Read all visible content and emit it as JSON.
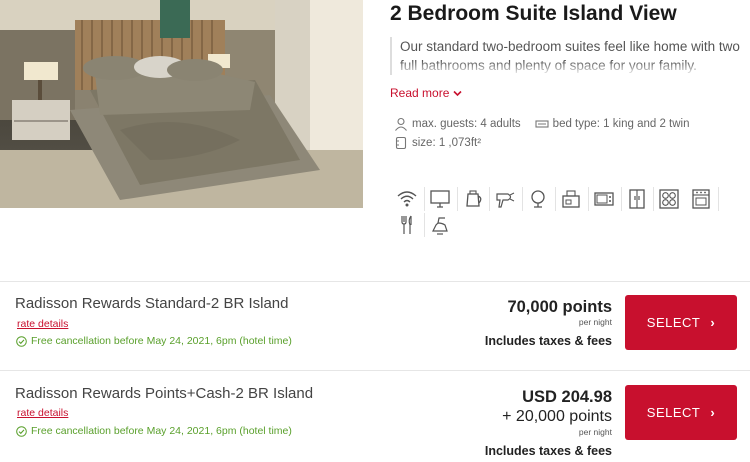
{
  "room": {
    "title": "2 Bedroom Suite Island View",
    "description": "Our standard two-bedroom suites feel like home with two full bathrooms and plenty of space for your family.",
    "read_more": "Read more",
    "guests": "max. guests: 4 adults",
    "bed": "bed type: 1 king and 2 twin",
    "size": "size: 1 ,073ft²"
  },
  "amenities": [
    "wifi-icon",
    "tv-icon",
    "kettle-icon",
    "hair-dryer-icon",
    "vanity-mirror-icon",
    "coffee-maker-icon",
    "microwave-icon",
    "refrigerator-icon",
    "cooktop-icon",
    "oven-icon",
    "cutlery-icon",
    "iron-icon"
  ],
  "rates": [
    {
      "name": "Radisson Rewards Standard-2 BR Island",
      "details_label": "rate details",
      "cancellation": "Free cancellation before May 24, 2021, 6pm (hotel time)",
      "price_main": "70,000 points",
      "per_night": "per night",
      "taxes": "Includes taxes & fees",
      "button": "SELECT"
    },
    {
      "name": "Radisson Rewards Points+Cash-2 BR Island",
      "details_label": "rate details",
      "cancellation": "Free cancellation before May 24, 2021, 6pm (hotel time)",
      "price_main": "USD 204.98",
      "price_extra": "+ 20,000 points",
      "per_night": "per night",
      "taxes": "Includes taxes & fees",
      "button": "SELECT"
    }
  ],
  "colors": {
    "accent": "#c8102e",
    "success": "#5aa02c"
  }
}
